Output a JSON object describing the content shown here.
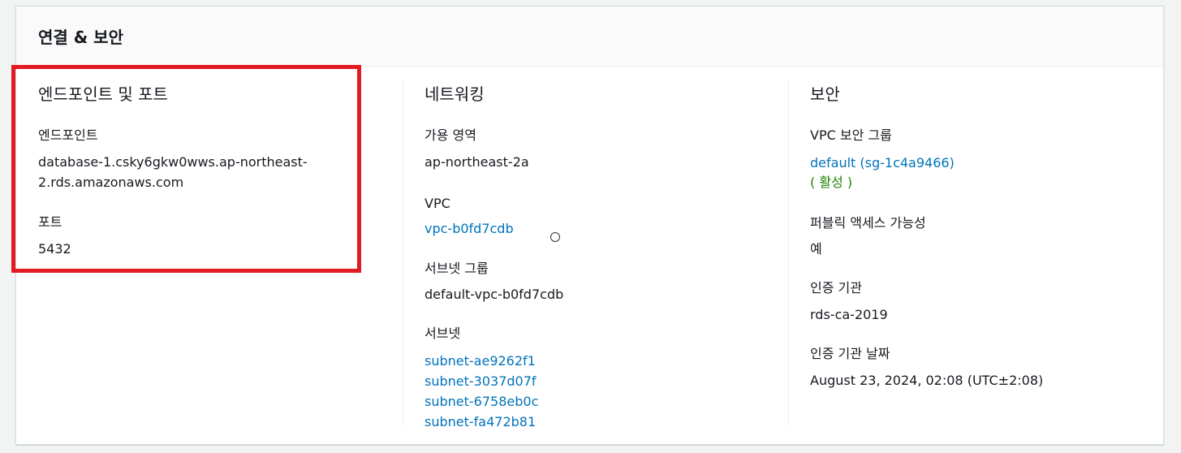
{
  "panel": {
    "title": "연결 & 보안"
  },
  "endpoint_port": {
    "title": "엔드포인트 및 포트",
    "endpoint_label": "엔드포인트",
    "endpoint_value_line1": "database-1.csky6gkw0wws.ap-northeast-",
    "endpoint_value_line2": "2.rds.amazonaws.com",
    "port_label": "포트",
    "port_value": "5432"
  },
  "networking": {
    "title": "네트워킹",
    "az_label": "가용 영역",
    "az_value": "ap-northeast-2a",
    "vpc_label": "VPC",
    "vpc_value": "vpc-b0fd7cdb",
    "subnet_group_label": "서브넷 그룹",
    "subnet_group_value": "default-vpc-b0fd7cdb",
    "subnets_label": "서브넷",
    "subnets": [
      "subnet-ae9262f1",
      "subnet-3037d07f",
      "subnet-6758eb0c",
      "subnet-fa472b81"
    ]
  },
  "security": {
    "title": "보안",
    "sg_label": "VPC 보안 그룹",
    "sg_value": "default (sg-1c4a9466)",
    "sg_status": "( 활성 )",
    "public_label": "퍼블릭 액세스 가능성",
    "public_value": "예",
    "ca_label": "인증 기관",
    "ca_value": "rds-ca-2019",
    "ca_date_label": "인증 기관 날짜",
    "ca_date_value": "August 23, 2024, 02:08 (UTC±2:08)"
  },
  "colors": {
    "link": "#0073bb",
    "active_status": "#1d8102",
    "highlight": "#e21b23"
  }
}
